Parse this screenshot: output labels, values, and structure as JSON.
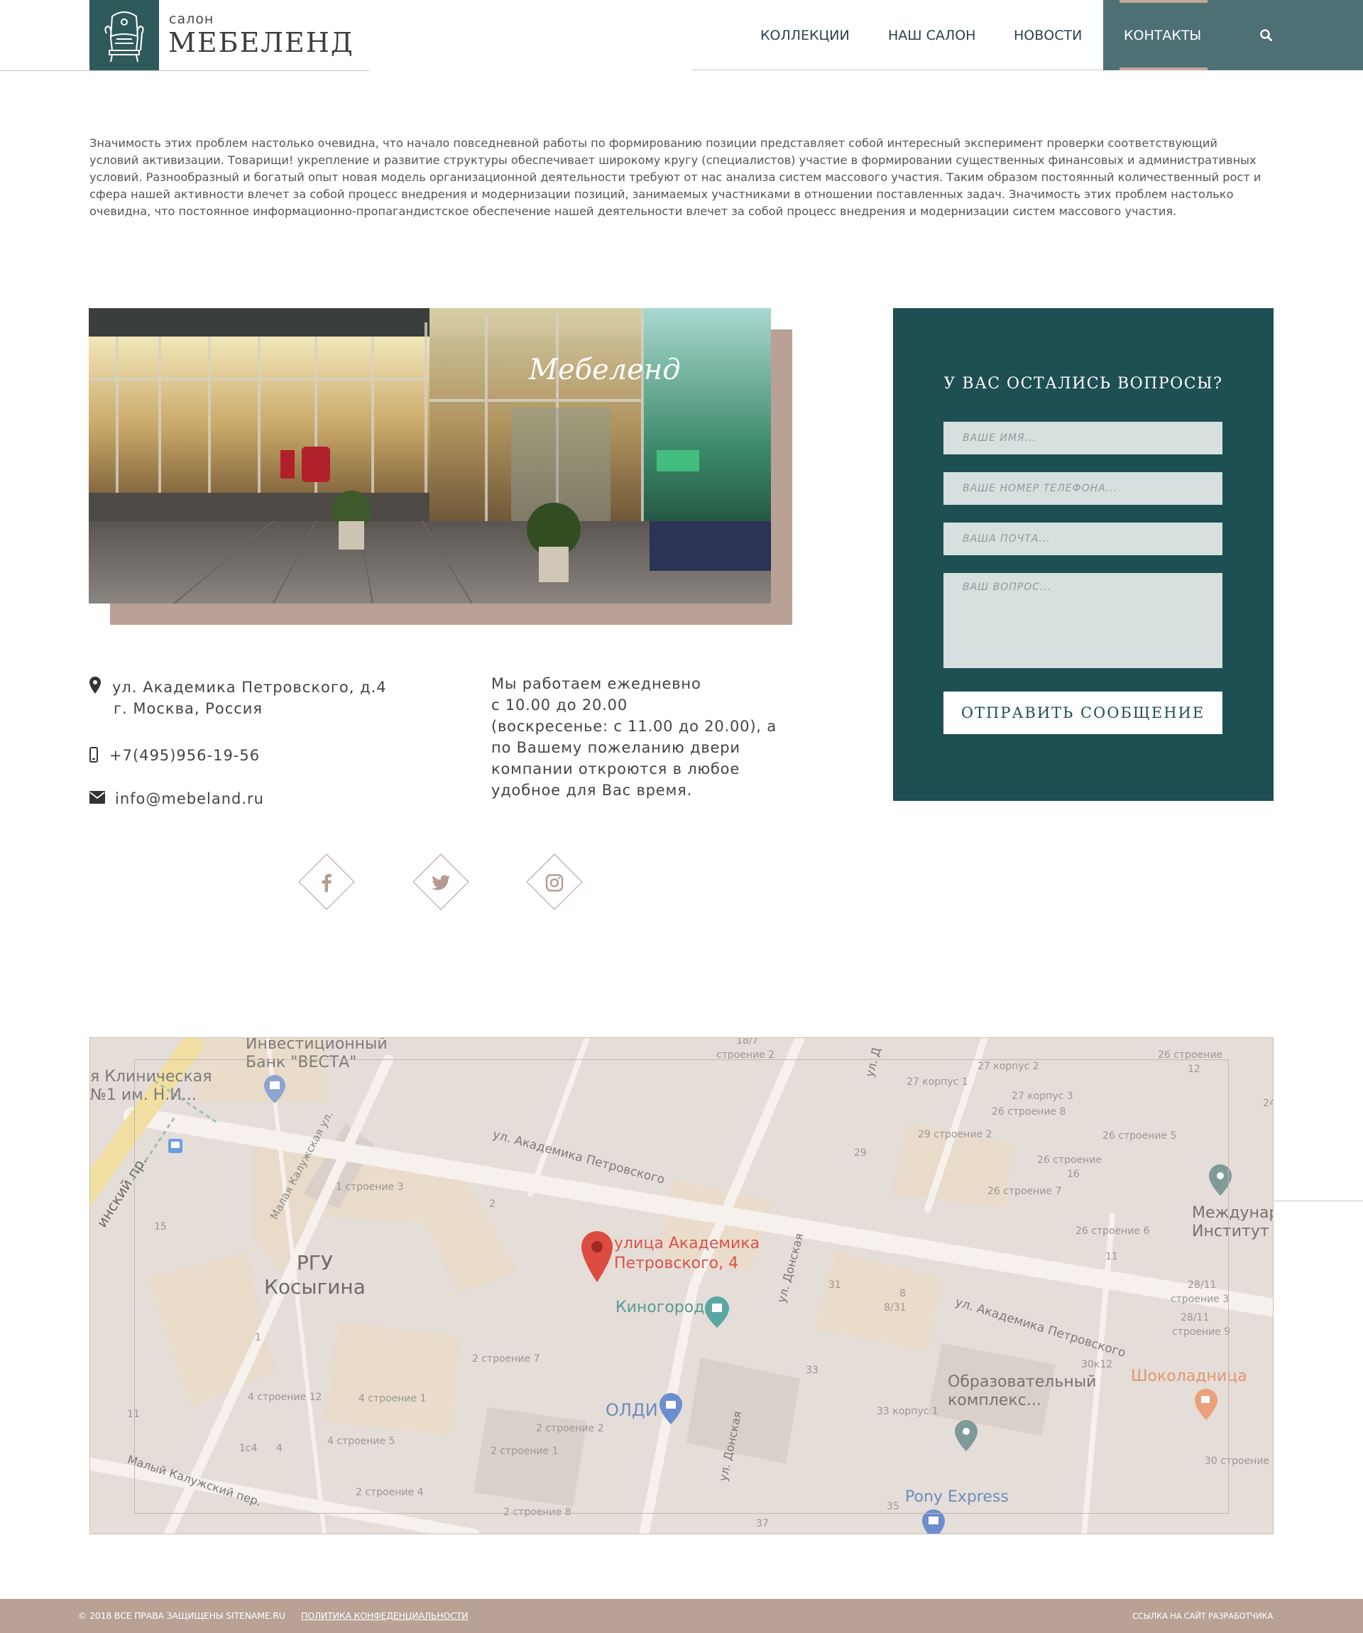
{
  "header": {
    "logo_small": "салон",
    "logo_big": "МЕБЕЛЕНД",
    "nav": [
      {
        "label": "КОЛЛЕКЦИИ"
      },
      {
        "label": "НАШ САЛОН"
      },
      {
        "label": "НОВОСТИ"
      },
      {
        "label": "КОНТАКТЫ",
        "active": true
      }
    ]
  },
  "intro": {
    "text": "Значимость этих проблем настолько очевидна, что начало повседневной работы по формированию позиции представляет собой интересный эксперимент проверки соответствующий условий активизации. Товарищи! укрепление и развитие структуры обеспечивает широкому кругу (специалистов) участие в формировании существенных финансовых и административных условий. Разнообразный и богатый опыт новая модель организационной деятельности требуют от нас анализа систем массового участия. Таким образом постоянный количественный рост и сфера нашей активности влечет за собой процесс внедрения и модернизации позиций, занимаемых участниками в отношении поставленных задач. Значимость этих проблем настолько очевидна, что постоянное информационно-пропагандистское обеспечение нашей деятельности влечет за собой процесс внедрения и модернизации систем массового участия."
  },
  "photo": {
    "sign": "Мебеленд"
  },
  "contacts": {
    "address_line1": "ул. Академика Петровского, д.4",
    "address_line2": "г. Москва, Россия",
    "phone": "+7(495)956-19-56",
    "email": "info@mebeland.ru",
    "hours": [
      "Мы работаем ежедневно",
      "с 10.00 до 20.00",
      "(воскресенье: с 11.00 до 20.00), а",
      "по Вашему пожеланию двери",
      "компании откроются в любое",
      "удобное для Вас время."
    ]
  },
  "social": [
    {
      "icon": "facebook-icon"
    },
    {
      "icon": "twitter-icon"
    },
    {
      "icon": "instagram-icon"
    }
  ],
  "form": {
    "title": "У ВАС ОСТАЛИСЬ ВОПРОСЫ?",
    "name_placeholder": "ВАШЕ ИМЯ...",
    "phone_placeholder": "ВАШЕ НОМЕР ТЕЛЕФОНА...",
    "email_placeholder": "ВАША ПОЧТА...",
    "question_placeholder": "ВАШ ВОПРОС...",
    "submit_label": "ОТПРАВИТЬ СООБЩЕНИЕ"
  },
  "map": {
    "pin_label_1": "улица Академика",
    "pin_label_2": "Петровского, 4",
    "labels": {
      "bank_1": "Инвестиционный",
      "bank_2": "Банк \"ВЕСТА\"",
      "clinic_1": "я Клиническая",
      "clinic_2": "№1 им. Н.И...",
      "street_main_1": "ул. Академика Петровского",
      "street_main_2": "ул. Академика Петровского",
      "malaya_kaluzhskaya": "Малая Калужская ул.",
      "leninsky": "инский пр.",
      "rgu_1": "РГУ",
      "rgu_2": "Косыгина",
      "kinogorod": "Киногород",
      "oldi": "ОЛДИ",
      "donskaya_1": "ул. Донская",
      "donskaya_2": "ул. Донская",
      "edu_1": "Образовательный",
      "edu_2": "комплекс...",
      "chocolate": "Шоколадница",
      "pony": "Pony Express",
      "mezhdunar_1": "Междунар",
      "mezhdunar_2": "Институт",
      "maly_kaluzhsky": "Малый Калужский пер.",
      "ul_d": "ул. Д"
    },
    "numbers": [
      {
        "t": "18/7"
      },
      {
        "t": "строение 2"
      },
      {
        "t": "27 корпус 2"
      },
      {
        "t": "27 корпус 1"
      },
      {
        "t": "27 корпус 3"
      },
      {
        "t": "26 строение 8"
      },
      {
        "t": "26 строение"
      },
      {
        "t": "12"
      },
      {
        "t": "29 строение 2"
      },
      {
        "t": "29"
      },
      {
        "t": "26 строение 5"
      },
      {
        "t": "26 строение"
      },
      {
        "t": "16"
      },
      {
        "t": "26 строение 7"
      },
      {
        "t": "26 строение 6"
      },
      {
        "t": "11"
      },
      {
        "t": "1 строение 3"
      },
      {
        "t": "2"
      },
      {
        "t": "15"
      },
      {
        "t": "1"
      },
      {
        "t": "31"
      },
      {
        "t": "8"
      },
      {
        "t": "8/31"
      },
      {
        "t": "28/11"
      },
      {
        "t": "строение 3"
      },
      {
        "t": "28/11"
      },
      {
        "t": "строение 9"
      },
      {
        "t": "2 строение 7"
      },
      {
        "t": "33"
      },
      {
        "t": "30к12"
      },
      {
        "t": "4 строение 12"
      },
      {
        "t": "4 строение 1"
      },
      {
        "t": "33 корпус 1"
      },
      {
        "t": "2 строение 2"
      },
      {
        "t": "1с4"
      },
      {
        "t": "4"
      },
      {
        "t": "4 строение 5"
      },
      {
        "t": "2 строение 1"
      },
      {
        "t": "30 строение"
      },
      {
        "t": "2 строение 4"
      },
      {
        "t": "2 строение 8"
      },
      {
        "t": "35"
      },
      {
        "t": "37"
      },
      {
        "t": "11"
      },
      {
        "t": "24"
      }
    ]
  },
  "footer": {
    "copyright": "© 2018 ВСЕ ПРАВА ЗАЩИЩЕНЫ SITENAME.RU",
    "policy": "ПОЛИТИКА КОНФЕДЕНЦИАЛЬНОСТИ",
    "developer": "ССЫЛКА НА САЙТ РАЗРАБОТЧИКА"
  },
  "colors": {
    "brand_teal": "#1d4f53",
    "nav_active": "#4d7075",
    "accent_beige": "#b9a196",
    "field_bg": "#d5e0df"
  }
}
